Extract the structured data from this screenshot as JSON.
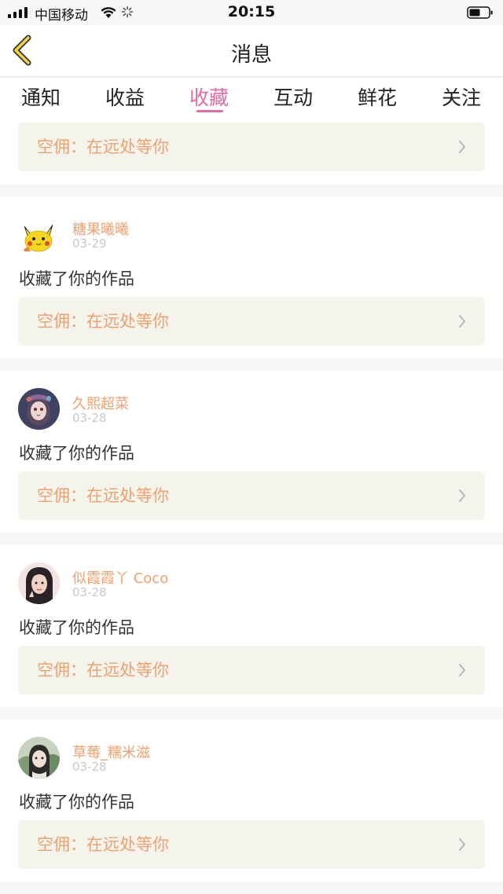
{
  "status_bar": {
    "carrier": "中国移动",
    "time": "20:15"
  },
  "header": {
    "title": "消息",
    "back_icon": "chevron-left-icon"
  },
  "tabs": [
    {
      "label": "通知",
      "active": false
    },
    {
      "label": "收益",
      "active": false
    },
    {
      "label": "收藏",
      "active": true
    },
    {
      "label": "互动",
      "active": false
    },
    {
      "label": "鲜花",
      "active": false
    },
    {
      "label": "关注",
      "active": false
    }
  ],
  "colors": {
    "accent": "#e36aa3",
    "username": "#f0a06e",
    "work_link_bg": "#f4f4ec",
    "date": "#c8c8c8"
  },
  "top_work_link": {
    "text": "空佣：在远处等你"
  },
  "notifications": [
    {
      "username": "糖果曦曦",
      "date": "03-29",
      "action": "收藏了你的作品",
      "work": "空佣：在远处等你",
      "avatar_icon": "pikachu-avatar"
    },
    {
      "username": "久熙超菜",
      "date": "03-28",
      "action": "收藏了你的作品",
      "work": "空佣：在远处等你",
      "avatar_icon": "anime-girl-avatar"
    },
    {
      "username": "似霞霞丫 Coco",
      "date": "03-28",
      "action": "收藏了你的作品",
      "work": "空佣：在远处等你",
      "avatar_icon": "selfie-avatar"
    },
    {
      "username": "草莓_糯米滋",
      "date": "03-28",
      "action": "收藏了你的作品",
      "work": "空佣：在远处等你",
      "avatar_icon": "anime-character-avatar"
    }
  ]
}
